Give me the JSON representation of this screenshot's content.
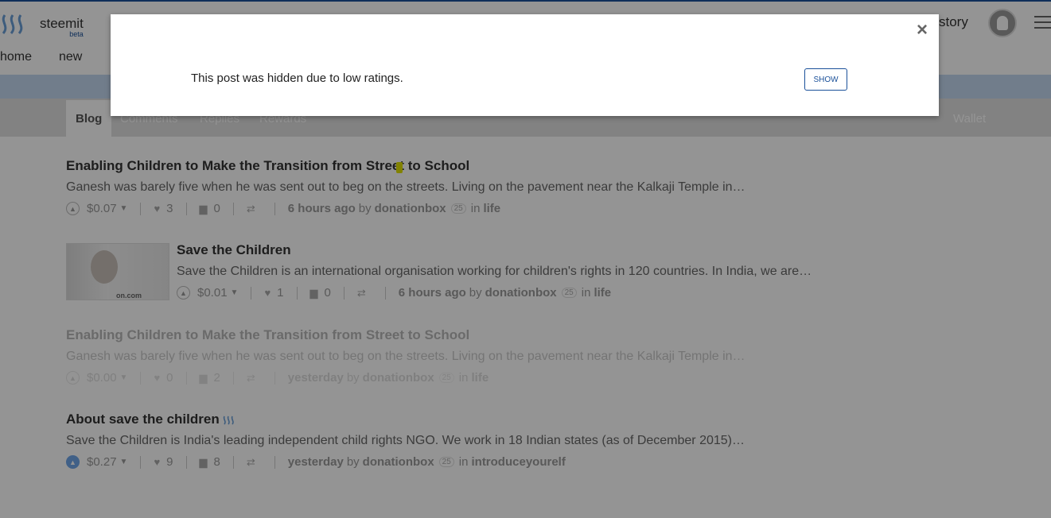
{
  "header": {
    "brand": "steemit",
    "beta": "beta",
    "story_label": "story",
    "icons": {
      "logo": "steem-logo-icon",
      "avatar": "user-avatar",
      "menu": "hamburger-menu-icon"
    }
  },
  "subnav": {
    "items": [
      "home",
      "new"
    ]
  },
  "tabs": {
    "items": [
      "Blog",
      "Comments",
      "Replies",
      "Rewards"
    ],
    "active": "Blog",
    "wallet": "Wallet"
  },
  "posts": [
    {
      "title": "Enabling Children to Make the Transition from Street to School",
      "body": "Ganesh was barely five when he was sent out to beg on the streets. Living on the pavement near the Kalkaji Temple in…",
      "payout": "$0.07",
      "voters": "3",
      "comments": "0",
      "when": "6 hours ago",
      "by": "by",
      "author": "donationbox",
      "rep": "25",
      "in": "in",
      "category": "life"
    },
    {
      "title": "Save the Children",
      "body": "Save the Children is an international organisation working for children's rights in 120 countries. In India, we are…",
      "payout": "$0.01",
      "voters": "1",
      "comments": "0",
      "when": "6 hours ago",
      "by": "by",
      "author": "donationbox",
      "rep": "25",
      "in": "in",
      "category": "life",
      "thumb_caption": "on.com"
    },
    {
      "title": "Enabling Children to Make the Transition from Street to School",
      "body": "Ganesh was barely five when he was sent out to beg on the streets. Living on the pavement near the Kalkaji Temple in…",
      "payout": "$0.00",
      "voters": "0",
      "comments": "2",
      "when": "yesterday",
      "by": "by",
      "author": "donationbox",
      "rep": "25",
      "in": "in",
      "category": "life"
    },
    {
      "title": "About save the children",
      "body": "Save the Children is India's leading independent child rights NGO. We work in 18 Indian states (as of December 2015)…",
      "payout": "$0.27",
      "voters": "9",
      "comments": "8",
      "when": "yesterday",
      "by": "by",
      "author": "donationbox",
      "rep": "25",
      "in": "in",
      "category": "introduceyourelf"
    }
  ],
  "modal": {
    "message": "This post was hidden due to low ratings.",
    "show_label": "SHOW",
    "close_glyph": "×"
  },
  "colors": {
    "accent": "#1a5099",
    "band": "#c3d7ef",
    "tabbar": "#e0e0e0",
    "voted": "#6ea6e8"
  }
}
